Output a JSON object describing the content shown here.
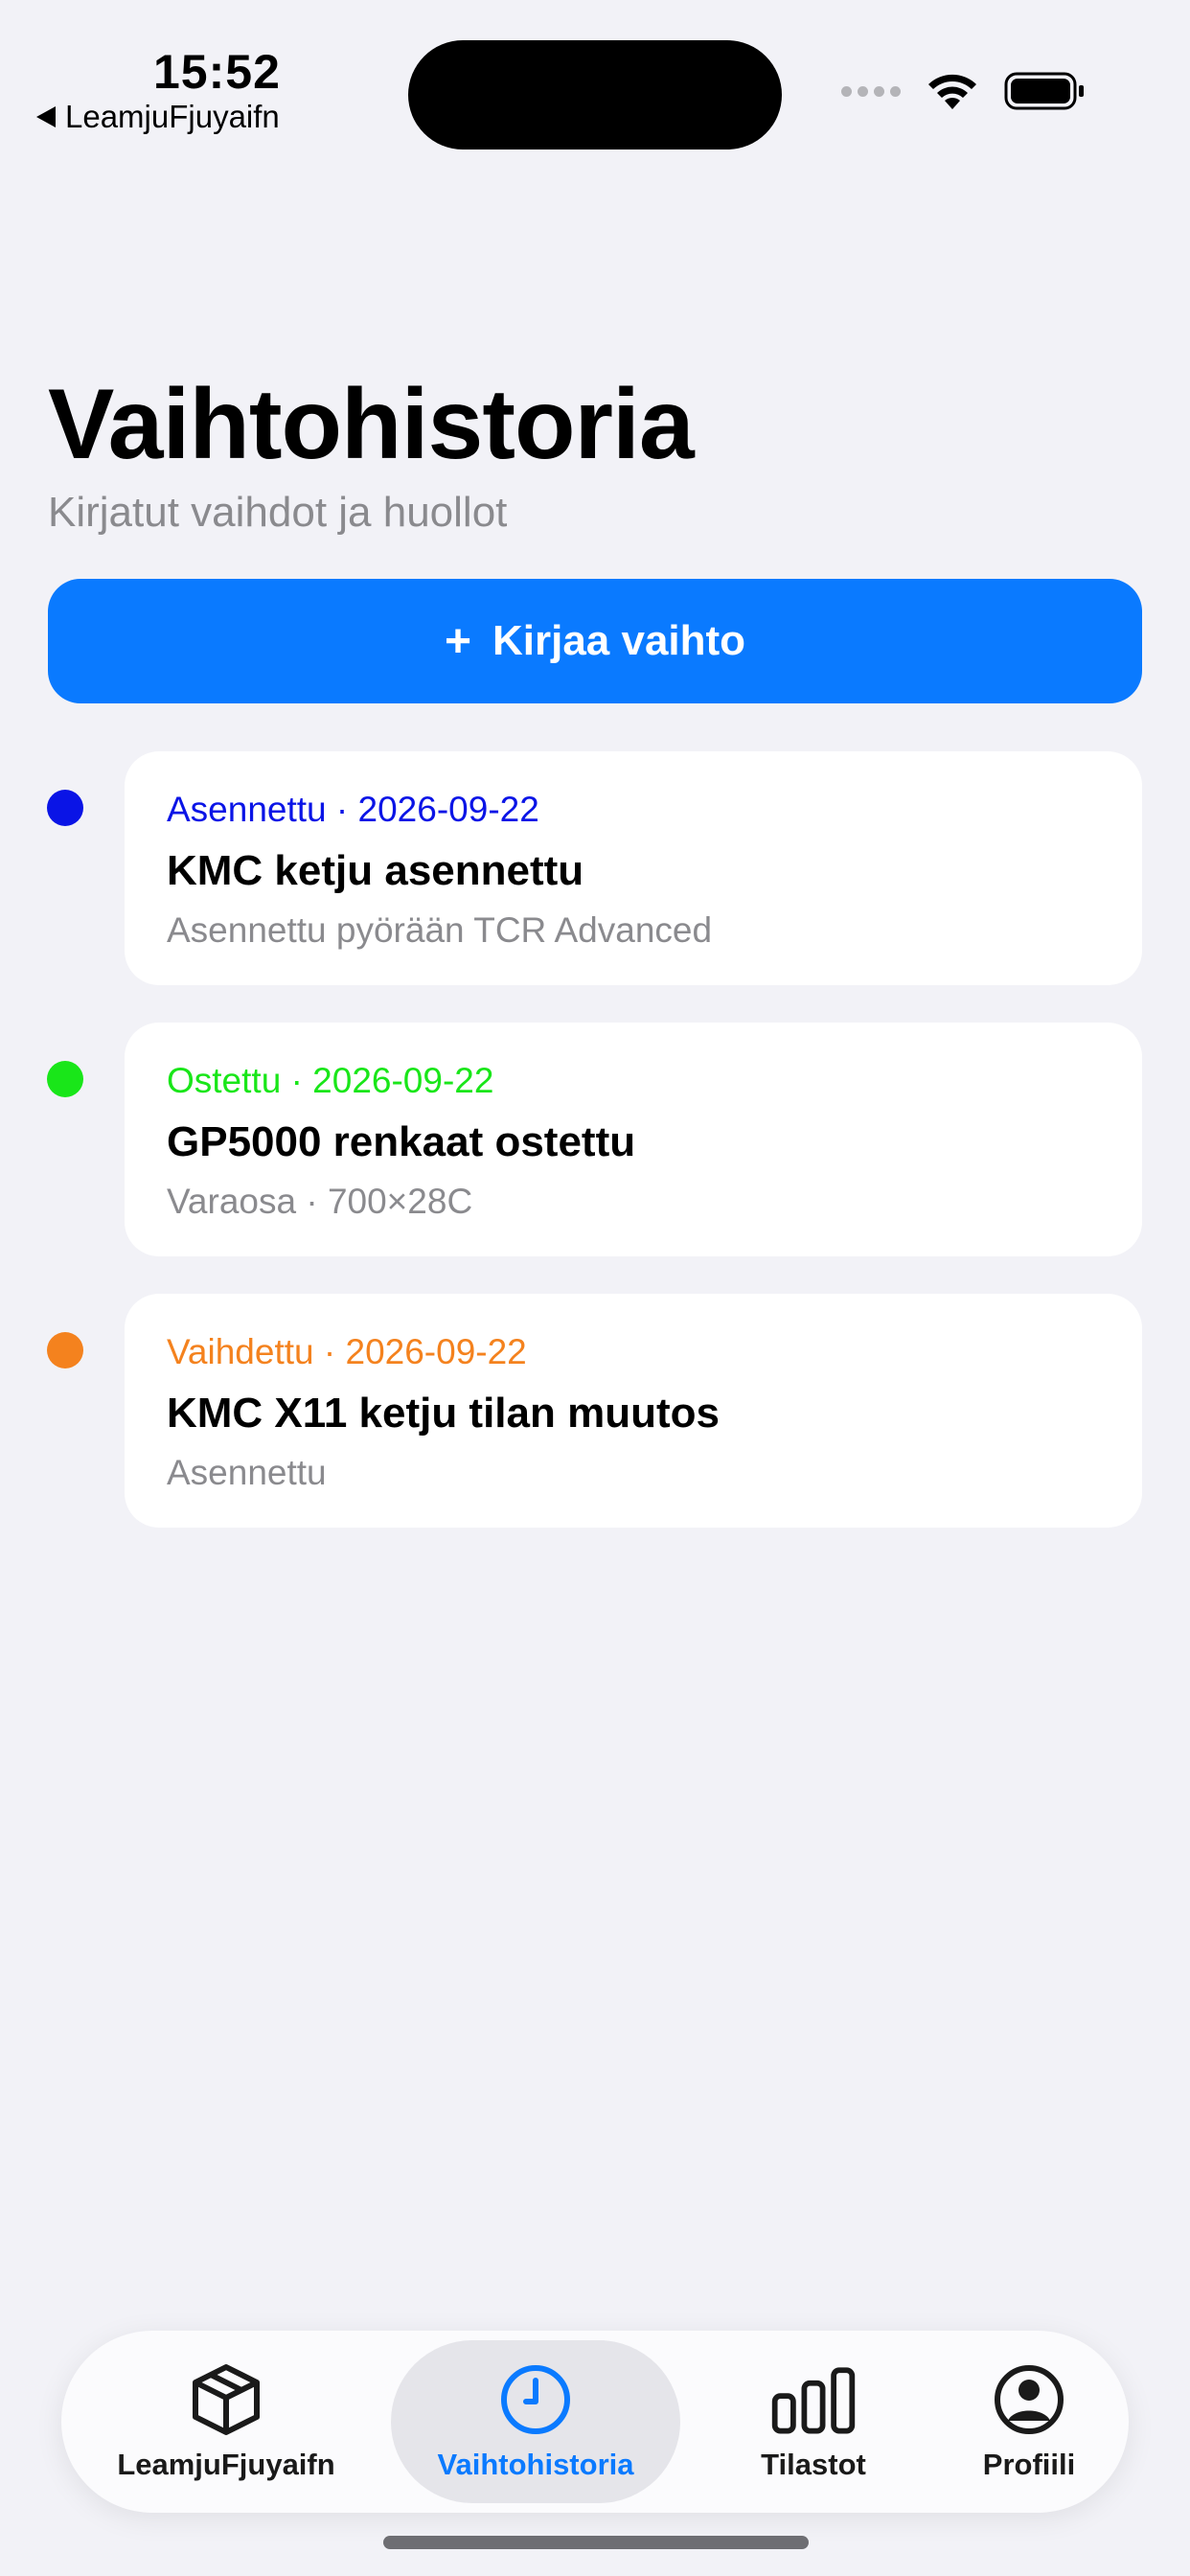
{
  "status_bar": {
    "time": "15:52",
    "back_label": "LeamjuFjuyaifn"
  },
  "header": {
    "title": "Vaihtohistoria",
    "subtitle": "Kirjatut vaihdot ja huollot"
  },
  "cta": {
    "icon": "plus-icon",
    "label": "Kirjaa vaihto"
  },
  "events": [
    {
      "status": "Asennettu",
      "separator": "·",
      "date": "2026-09-22",
      "title": "KMC ketju asennettu",
      "detail": "Asennettu pyörään TCR Advanced",
      "color": "#0a14e6"
    },
    {
      "status": "Ostettu",
      "separator": "·",
      "date": "2026-09-22",
      "title": "GP5000 renkaat ostettu",
      "detail": "Varaosa · 700×28C",
      "color": "#19e619"
    },
    {
      "status": "Vaihdettu",
      "separator": "·",
      "date": "2026-09-22",
      "title": "KMC X11 ketju tilan muutos",
      "detail": "Asennettu",
      "color": "#f4821e"
    }
  ],
  "tab_bar": {
    "active": "Vaihtohistoria",
    "accent": "#0a7aff",
    "tabs": [
      {
        "label": "LeamjuFjuyaifn",
        "icon": "box-icon"
      },
      {
        "label": "Vaihtohistoria",
        "icon": "clock-icon"
      },
      {
        "label": "Tilastot",
        "icon": "bar-chart-icon"
      },
      {
        "label": "Profiili",
        "icon": "person-icon"
      }
    ]
  }
}
